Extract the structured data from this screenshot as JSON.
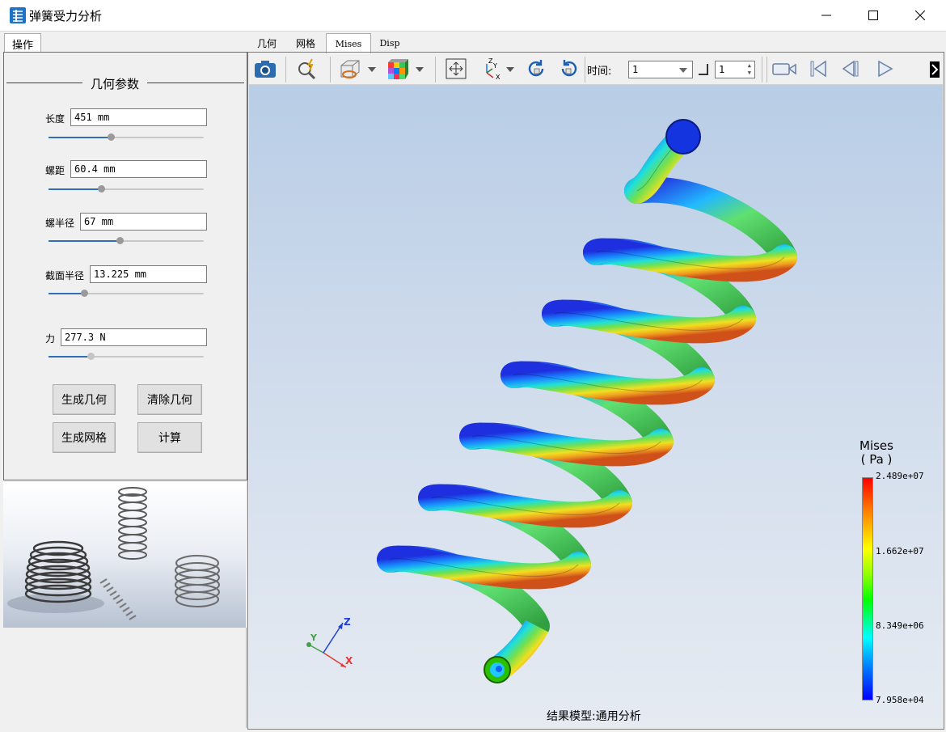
{
  "window": {
    "title": "弹簧受力分析"
  },
  "left_tabs": [
    "操作"
  ],
  "geometry_group": {
    "title": "几何参数",
    "params": [
      {
        "label": "长度",
        "value": "451 mm",
        "slider": 0.4
      },
      {
        "label": "螺距",
        "value": "60.4 mm",
        "slider": 0.34
      },
      {
        "label": "螺半径",
        "value": "67 mm",
        "slider": 0.46
      },
      {
        "label": "截面半径",
        "value": "13.225 mm",
        "slider": 0.23
      },
      {
        "label": "力",
        "value": "277.3 N",
        "slider": 0.27
      }
    ]
  },
  "buttons": {
    "gen_geometry": "生成几何",
    "clear_geometry": "清除几何",
    "gen_mesh": "生成网格",
    "compute": "计算"
  },
  "right_tabs": [
    "几何",
    "网格",
    "Mises",
    "Disp"
  ],
  "active_right_tab": "Mises",
  "toolbar": {
    "time_label": "时间:",
    "time_value": "1",
    "step_value": "1",
    "icons": [
      "camera-icon",
      "zoom-icon",
      "section-view-icon",
      "colormap-icon",
      "fit-view-icon",
      "axes-icon",
      "rotate-left-icon",
      "rotate-right-icon",
      "record-icon",
      "first-frame-icon",
      "prev-frame-icon",
      "play-icon"
    ]
  },
  "legend": {
    "title_line1": "Mises",
    "title_line2": "( Pa )",
    "ticks": [
      "2.489e+07",
      "1.662e+07",
      "8.349e+06",
      "7.958e+04"
    ],
    "colors": [
      "#ff0000",
      "#ffff00",
      "#00ff00",
      "#00ffff",
      "#0000ff"
    ]
  },
  "axes": {
    "x": "X",
    "y": "Y",
    "z": "Z"
  },
  "viewport_caption": "结果模型:通用分析"
}
